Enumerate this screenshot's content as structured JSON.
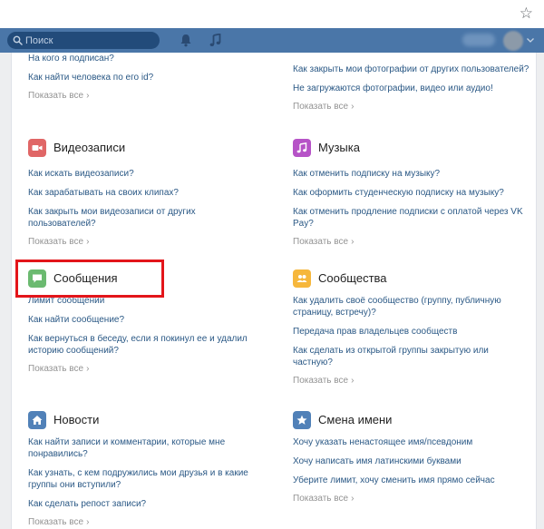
{
  "browser": {
    "star_icon": "star-outline-icon",
    "star_glyph": "☆"
  },
  "nav": {
    "search_placeholder": "Поиск",
    "icons": [
      "search-icon",
      "bell-icon",
      "music-note-icon",
      "chevron-down-icon"
    ],
    "colors": {
      "bar": "#4a76a8",
      "search_bg": "#224b7a"
    }
  },
  "sections": {
    "top_left": {
      "questions": [
        "На кого я подписан?",
        "Как найти человека по его id?"
      ],
      "more": "Показать все"
    },
    "top_right": {
      "questions": [
        "Как закрыть мои фотографии от других пользователей?",
        "Не загружаются фотографии, видео или аудио!"
      ],
      "more": "Показать все"
    },
    "videos": {
      "title": "Видеозаписи",
      "icon": "video-camera-icon",
      "color": "#e06666",
      "questions": [
        "Как искать видеозаписи?",
        "Как зарабатывать на своих клипах?",
        "Как закрыть мои видеозаписи от других пользователей?"
      ],
      "more": "Показать все"
    },
    "music": {
      "title": "Музыка",
      "icon": "music-note-icon",
      "color": "#b653c7",
      "questions": [
        "Как отменить подписку на музыку?",
        "Как оформить студенческую подписку на музыку?",
        "Как отменить продление подписки с оплатой через VK Pay?"
      ],
      "more": "Показать все"
    },
    "messages": {
      "title": "Сообщения",
      "icon": "chat-bubble-icon",
      "color": "#6bba70",
      "questions": [
        "Лимит сообщений",
        "Как найти сообщение?",
        "Как вернуться в беседу, если я покинул ее и удалил историю сообщений?"
      ],
      "more": "Показать все"
    },
    "communities": {
      "title": "Сообщества",
      "icon": "people-icon",
      "color": "#f6b73c",
      "questions": [
        "Как удалить своё сообщество (группу, публичную страницу, встречу)?",
        "Передача прав владельцев сообществ",
        "Как сделать из открытой группы закрытую или частную?"
      ],
      "more": "Показать все"
    },
    "news": {
      "title": "Новости",
      "icon": "home-icon",
      "color": "#5181b8",
      "questions": [
        "Как найти записи и комментарии, которые мне понравились?",
        "Как узнать, с кем подружились мои друзья и в какие группы они вступили?",
        "Как сделать репост записи?"
      ],
      "more": "Показать все"
    },
    "rename": {
      "title": "Смена имени",
      "icon": "star-icon",
      "color": "#5181b8",
      "questions": [
        "Хочу указать ненастоящее имя/псевдоним",
        "Хочу написать имя латинскими буквами",
        "Уберите лимит, хочу сменить имя прямо сейчас"
      ],
      "more": "Показать все"
    }
  },
  "highlight": {
    "color": "#e3151a",
    "target": "Сообщения"
  }
}
